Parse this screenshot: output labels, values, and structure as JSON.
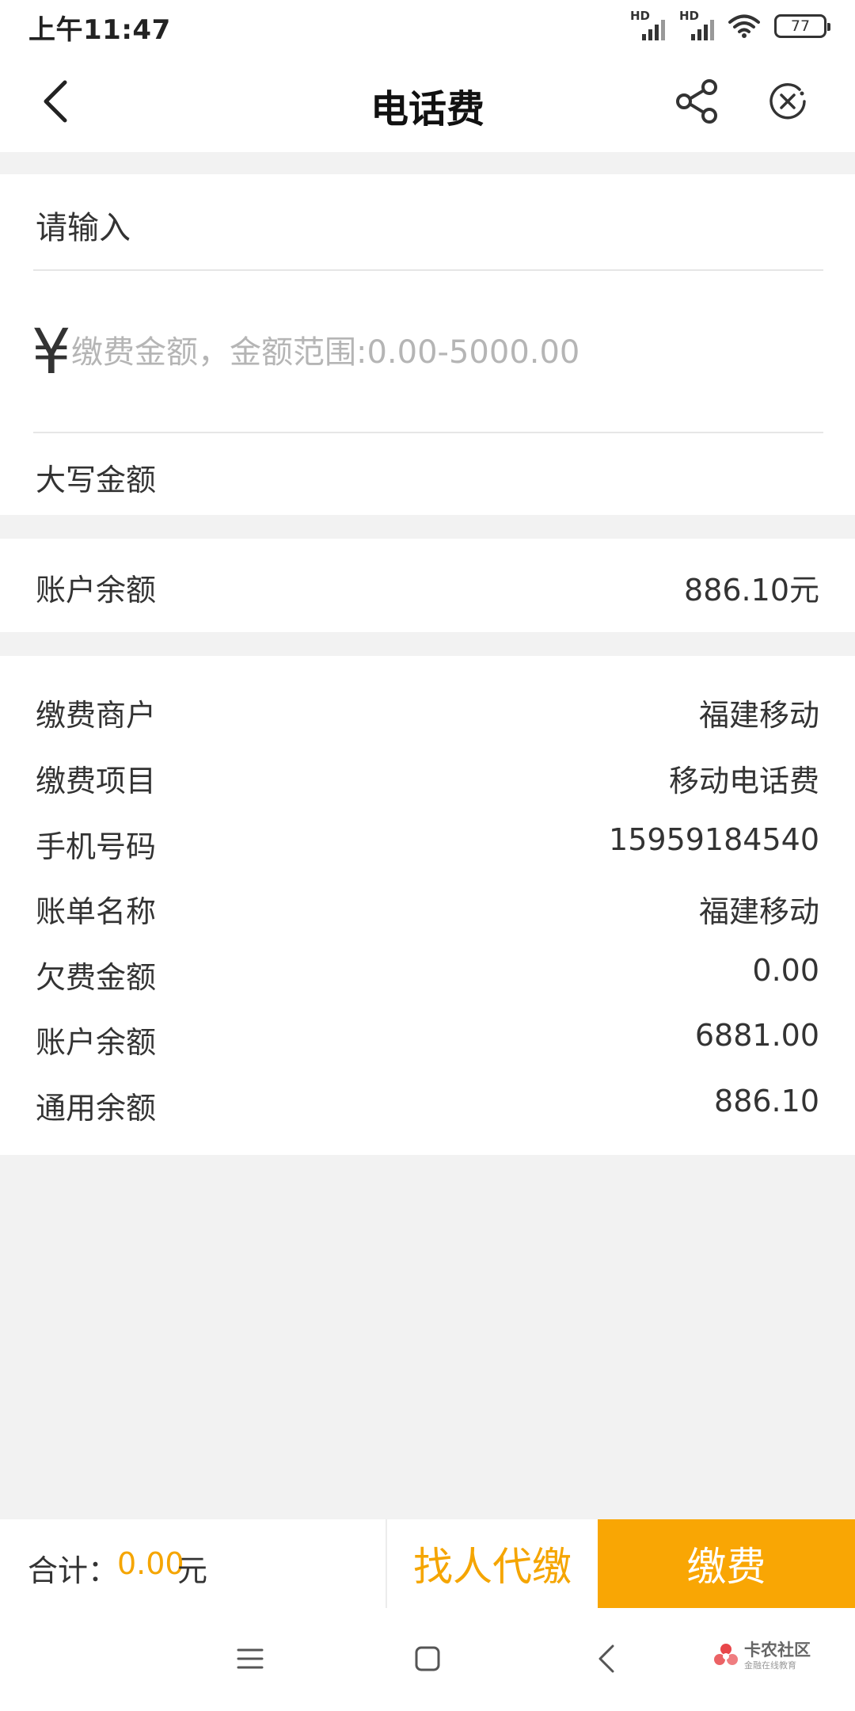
{
  "status_bar": {
    "time": "上午11:47",
    "signal_1_label": "HD",
    "signal_2_label": "HD",
    "battery": "77"
  },
  "header": {
    "title": "电话费",
    "back_icon": "chevron-left-icon",
    "share_icon": "share-icon",
    "close_icon": "close-circle-icon"
  },
  "input_section": {
    "title": "请输入",
    "currency_symbol": "¥",
    "amount_value": "",
    "amount_placeholder": "缴费金额，金额范围:0.00-5000.00",
    "capital_amount_label": "大写金额"
  },
  "balance_section": {
    "label": "账户余额",
    "value": "886.10元"
  },
  "details": [
    {
      "label": "缴费商户",
      "value": "福建移动"
    },
    {
      "label": "缴费项目",
      "value": "移动电话费"
    },
    {
      "label": "手机号码",
      "value": "15959184540"
    },
    {
      "label": "账单名称",
      "value": "福建移动"
    },
    {
      "label": "欠费金额",
      "value": "0.00"
    },
    {
      "label": "账户余额",
      "value": "6881.00"
    },
    {
      "label": "通用余额",
      "value": "886.10"
    }
  ],
  "bottom_bar": {
    "total_label": "合计：",
    "total_value": "0.00",
    "total_unit": "元",
    "proxy_pay_label": "找人代缴",
    "pay_label": "缴费"
  },
  "watermark": {
    "main": "卡农社区",
    "sub": "金融在线教育"
  },
  "colors": {
    "accent": "#f9a604",
    "accent_text": "#f5a500",
    "page_background": "#f2f2f2"
  }
}
